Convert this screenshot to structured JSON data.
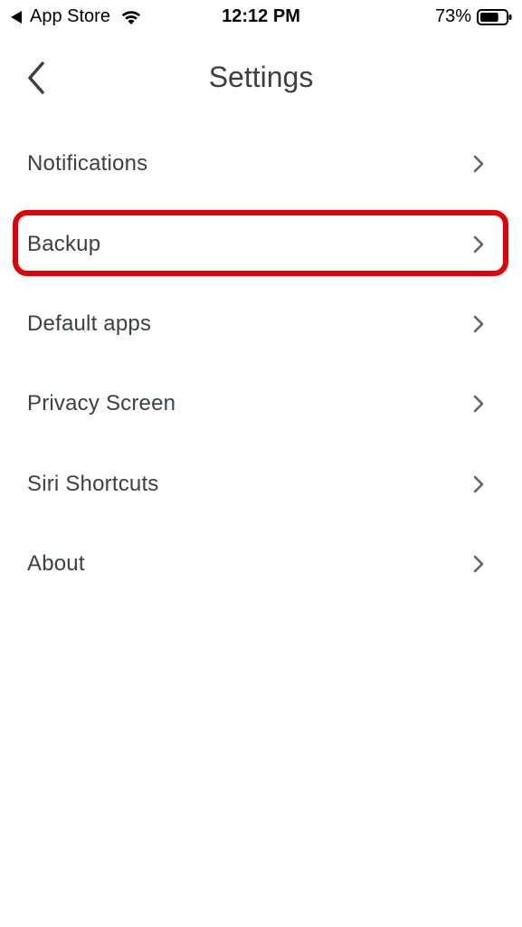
{
  "status_bar": {
    "back_app_label": "App Store",
    "time": "12:12 PM",
    "battery_percent": "73%",
    "battery_level": 0.73
  },
  "header": {
    "title": "Settings",
    "back_icon": "chevron-left-icon"
  },
  "settings": {
    "items": [
      {
        "label": "Notifications"
      },
      {
        "label": "Backup",
        "highlighted": true,
        "highlight_color": "#e00008"
      },
      {
        "label": "Default apps"
      },
      {
        "label": "Privacy Screen"
      },
      {
        "label": "Siri Shortcuts"
      },
      {
        "label": "About"
      }
    ]
  }
}
